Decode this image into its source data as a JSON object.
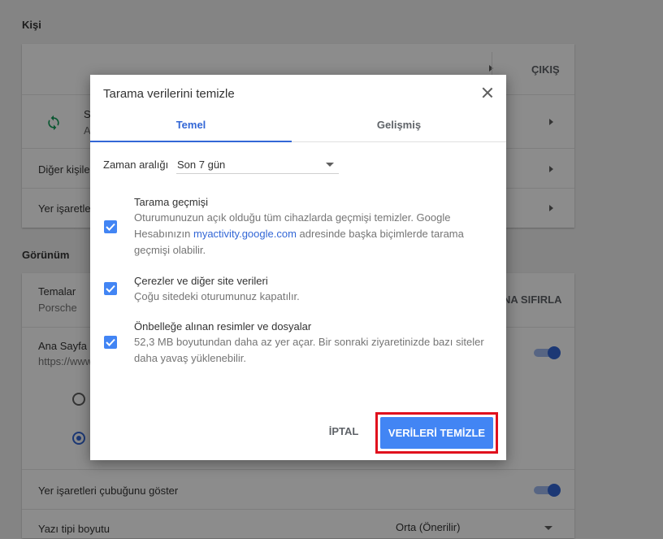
{
  "settings": {
    "people_section": "Kişi",
    "signout": "ÇIKIŞ",
    "other_people": "Diğer kişile",
    "bookmarks_import": "Yer işaretle",
    "sync_initial": "S",
    "sync_sub_initial": "A",
    "appearance_section": "Görünüm",
    "themes_label": "Temalar",
    "themes_value": "Porsche",
    "reset_theme": "NA SIFIRLA",
    "home_label": "Ana Sayfa d",
    "home_url": "https://www",
    "bookmarks_bar": "Yer işaretleri çubuğunu göster",
    "font_size_label": "Yazı tipi boyutu",
    "font_size_value": "Orta (Önerilir)",
    "sync_icon": "sync-icon",
    "colors": {
      "accent": "#3367d6",
      "button": "#4285f4",
      "highlight": "#e0101d"
    }
  },
  "dialog": {
    "title": "Tarama verilerini temizle",
    "tabs": [
      {
        "label": "Temel"
      },
      {
        "label": "Gelişmiş"
      }
    ],
    "time_range_label": "Zaman aralığı",
    "time_range_value": "Son 7 gün",
    "options": [
      {
        "title": "Tarama geçmişi",
        "desc_1": "Oturumunuzun açık olduğu tüm cihazlarda geçmişi temizler. Google Hesabınızın ",
        "desc_link": "myactivity.google.com",
        "desc_2": " adresinde başka biçimlerde tarama geçmişi olabilir.",
        "checked": true
      },
      {
        "title": "Çerezler ve diğer site verileri",
        "desc": "Çoğu sitedeki oturumunuz kapatılır.",
        "checked": true
      },
      {
        "title": "Önbelleğe alınan resimler ve dosyalar",
        "desc": "52,3 MB boyutundan daha az yer açar. Bir sonraki ziyaretinizde bazı siteler daha yavaş yüklenebilir.",
        "checked": true
      }
    ],
    "cancel_label": "İPTAL",
    "confirm_label": "VERİLERİ TEMİZLE"
  }
}
